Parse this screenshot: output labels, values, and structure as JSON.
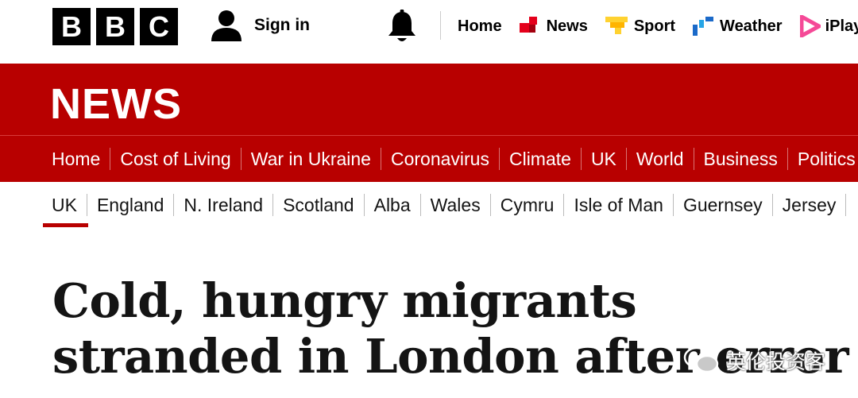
{
  "masthead": {
    "logo": [
      "B",
      "B",
      "C"
    ],
    "signin_label": "Sign in",
    "top_nav": [
      {
        "label": "Home",
        "icon": "none"
      },
      {
        "label": "News",
        "icon": "news-icon",
        "color": "#e4001b"
      },
      {
        "label": "Sport",
        "icon": "sport-icon",
        "color": "#ffd230"
      },
      {
        "label": "Weather",
        "icon": "weather-icon",
        "color": "#1b6ac9"
      },
      {
        "label": "iPlayer",
        "icon": "iplayer-icon",
        "color": "#f54997"
      }
    ]
  },
  "banner": {
    "title": "NEWS",
    "color": "#b80000"
  },
  "primary_nav": {
    "items": [
      "Home",
      "Cost of Living",
      "War in Ukraine",
      "Coronavirus",
      "Climate",
      "UK",
      "World",
      "Business",
      "Politics"
    ],
    "active": "UK"
  },
  "secondary_nav": {
    "items": [
      "UK",
      "England",
      "N. Ireland",
      "Scotland",
      "Alba",
      "Wales",
      "Cymru",
      "Isle of Man",
      "Guernsey",
      "Jersey"
    ],
    "active": "UK"
  },
  "article": {
    "headline_line1": "Cold, hungry migrants",
    "headline_line2": "stranded in London after error"
  },
  "watermark": {
    "text": "英伦投资客",
    "icon": "wechat-icon"
  }
}
